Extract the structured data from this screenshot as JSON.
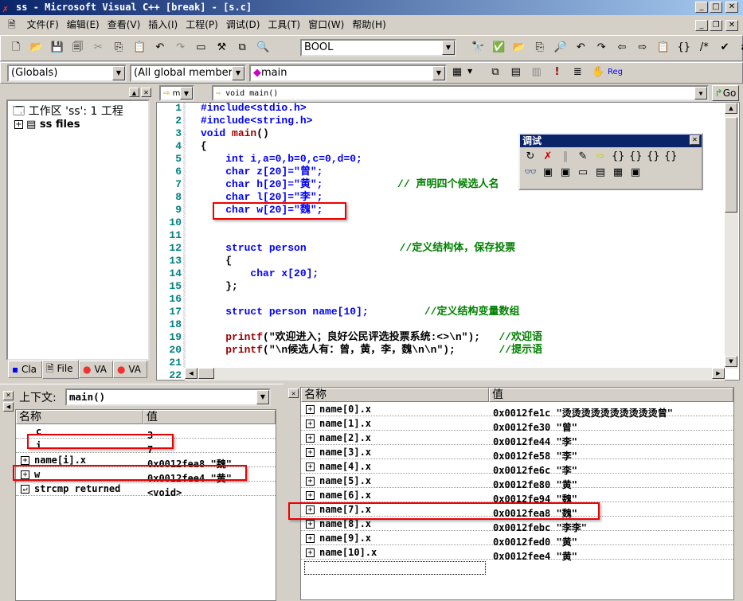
{
  "window": {
    "title": "ss - Microsoft Visual C++ [break] - [s.c]"
  },
  "menu": [
    "文件(F)",
    "编辑(E)",
    "查看(V)",
    "插入(I)",
    "工程(P)",
    "调试(D)",
    "工具(T)",
    "窗口(W)",
    "帮助(H)"
  ],
  "toolbar": {
    "find_combo": "BOOL",
    "class_combo": "(Globals)",
    "members_combo": "(All global members",
    "function_combo": "main",
    "reg_label": "Reg"
  },
  "workspace": {
    "root": "工作区 'ss': 1 工程",
    "child": "ss files",
    "tabs": [
      "Cla",
      "File",
      "VA",
      "VA"
    ]
  },
  "editor": {
    "nav_combo": "m",
    "func_combo": "void main()",
    "go_label": "Go",
    "lines": [
      [
        [
          "kw",
          "#include<stdio.h>"
        ]
      ],
      [
        [
          "kw",
          "#include<string.h>"
        ]
      ],
      [
        [
          "kw",
          "void "
        ],
        [
          "fn",
          "main"
        ],
        [
          "tx",
          "()"
        ]
      ],
      [
        [
          "tx",
          "{"
        ]
      ],
      [
        [
          "tx",
          "    "
        ],
        [
          "kw",
          "int i,a=0,b=0,c=0,d=0;"
        ]
      ],
      [
        [
          "tx",
          "    "
        ],
        [
          "kw",
          "char z[20]=\"曾\";"
        ]
      ],
      [
        [
          "tx",
          "    "
        ],
        [
          "kw",
          "char h[20]=\"黄\";"
        ],
        [
          "cm",
          "            // 声明四个候选人名"
        ]
      ],
      [
        [
          "tx",
          "    "
        ],
        [
          "kw",
          "char l[20]=\"李\";"
        ]
      ],
      [
        [
          "tx",
          "    "
        ],
        [
          "kw",
          "char w[20]=\"魏\";"
        ]
      ],
      [],
      [],
      [
        [
          "tx",
          "    "
        ],
        [
          "kw",
          "struct person"
        ],
        [
          "cm",
          "               //定义结构体，保存投票"
        ]
      ],
      [
        [
          "tx",
          "    {"
        ]
      ],
      [
        [
          "tx",
          "        "
        ],
        [
          "kw",
          "char x[20];"
        ]
      ],
      [
        [
          "tx",
          "    };"
        ]
      ],
      [],
      [
        [
          "tx",
          "    "
        ],
        [
          "kw",
          "struct person name[10];"
        ],
        [
          "cm",
          "         //定义结构变量数组"
        ]
      ],
      [],
      [
        [
          "tx",
          "    "
        ],
        [
          "fn",
          "printf"
        ],
        [
          "tx",
          "(\"欢迎进入；良好公民评选投票系统:<>\\n\");"
        ],
        [
          "cm",
          "   //欢迎语"
        ]
      ],
      [
        [
          "tx",
          "    "
        ],
        [
          "fn",
          "printf"
        ],
        [
          "tx",
          "(\"\\n候选人有：曾，黄，李，魏\\n\\n\");"
        ],
        [
          "cm",
          "       //提示语"
        ]
      ],
      [],
      []
    ]
  },
  "debug_toolbar": {
    "title": "调试"
  },
  "variables": {
    "context_label": "上下文:",
    "context_value": "main()",
    "col_name": "名称",
    "col_value": "值",
    "rows": [
      {
        "name": "c",
        "value": "3",
        "expand": ""
      },
      {
        "name": "i",
        "value": "7",
        "expand": ""
      },
      {
        "name": "name[i].x",
        "value": "0x0012fea8 \"魏\"",
        "expand": "+"
      },
      {
        "name": "w",
        "value": "0x0012fee4 \"黄\"",
        "expand": "+"
      },
      {
        "name": "strcmp returned",
        "value": "<void>",
        "expand": "↵"
      }
    ]
  },
  "watch": {
    "col_name": "名称",
    "col_value": "值",
    "rows": [
      {
        "name": "name[0].x",
        "value": "0x0012fe1c \"烫烫烫烫烫烫烫烫烫烫曾\""
      },
      {
        "name": "name[1].x",
        "value": "0x0012fe30 \"曾\""
      },
      {
        "name": "name[2].x",
        "value": "0x0012fe44 \"李\""
      },
      {
        "name": "name[3].x",
        "value": "0x0012fe58 \"李\""
      },
      {
        "name": "name[4].x",
        "value": "0x0012fe6c \"李\""
      },
      {
        "name": "name[5].x",
        "value": "0x0012fe80 \"黄\""
      },
      {
        "name": "name[6].x",
        "value": "0x0012fe94 \"魏\""
      },
      {
        "name": "name[7].x",
        "value": "0x0012fea8 \"魏\""
      },
      {
        "name": "name[8].x",
        "value": "0x0012febc \"李李\""
      },
      {
        "name": "name[9].x",
        "value": "0x0012fed0 \"黄\""
      },
      {
        "name": "name[10].x",
        "value": "0x0012fee4 \"黄\""
      }
    ]
  },
  "colors": {
    "highlight": "#ee0000",
    "title_bar": "#0a246a",
    "keyword": "#0000ff",
    "comment": "#008000",
    "function": "#990000"
  }
}
